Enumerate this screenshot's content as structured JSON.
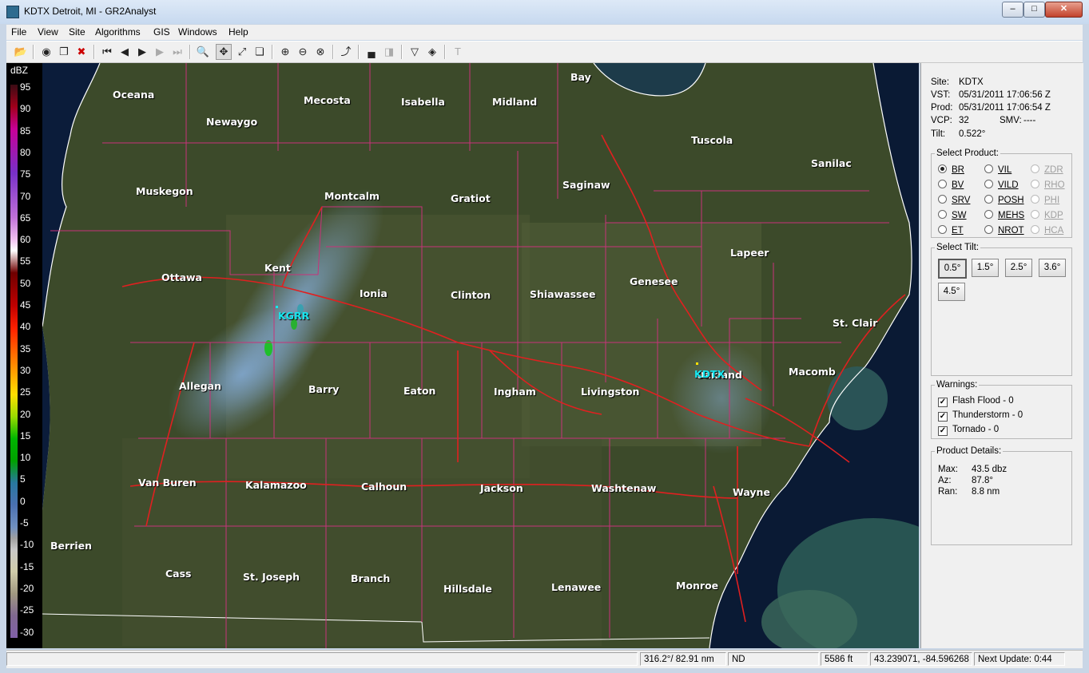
{
  "window": {
    "title": "KDTX Detroit, MI - GR2Analyst",
    "minimize": "–",
    "maximize": "□",
    "close": "✕"
  },
  "menu": [
    "File",
    "View",
    "Site",
    "Algorithms",
    "GIS",
    "Windows",
    "Help"
  ],
  "legend": {
    "unit": "dBZ",
    "labels": [
      "95",
      "90",
      "85",
      "80",
      "75",
      "70",
      "65",
      "60",
      "55",
      "50",
      "45",
      "40",
      "35",
      "30",
      "25",
      "20",
      "15",
      "10",
      "5",
      "0",
      "-5",
      "-10",
      "-15",
      "-20",
      "-25",
      "-30"
    ]
  },
  "map": {
    "counties": [
      {
        "name": "Oceana"
      },
      {
        "name": "Mecosta"
      },
      {
        "name": "Isabella"
      },
      {
        "name": "Midland"
      },
      {
        "name": "Bay"
      },
      {
        "name": "Newaygo"
      },
      {
        "name": "Tuscola"
      },
      {
        "name": "Sanilac"
      },
      {
        "name": "Muskegon"
      },
      {
        "name": "Montcalm"
      },
      {
        "name": "Gratiot"
      },
      {
        "name": "Saginaw"
      },
      {
        "name": "Lapeer"
      },
      {
        "name": "Kent"
      },
      {
        "name": "Ottawa"
      },
      {
        "name": "Genesee"
      },
      {
        "name": "Ionia"
      },
      {
        "name": "Clinton"
      },
      {
        "name": "Shiawassee"
      },
      {
        "name": "St. Clair"
      },
      {
        "name": "Oakland"
      },
      {
        "name": "Macomb"
      },
      {
        "name": "Allegan"
      },
      {
        "name": "Barry"
      },
      {
        "name": "Eaton"
      },
      {
        "name": "Ingham"
      },
      {
        "name": "Livingston"
      },
      {
        "name": "Van Buren"
      },
      {
        "name": "Kalamazoo"
      },
      {
        "name": "Calhoun"
      },
      {
        "name": "Jackson"
      },
      {
        "name": "Washtenaw"
      },
      {
        "name": "Wayne"
      },
      {
        "name": "Berrien"
      },
      {
        "name": "Cass"
      },
      {
        "name": "St. Joseph"
      },
      {
        "name": "Branch"
      },
      {
        "name": "Hillsdale"
      },
      {
        "name": "Lenawee"
      },
      {
        "name": "Monroe"
      }
    ],
    "radars": [
      {
        "name": "KGRR"
      },
      {
        "name": "KDTX"
      }
    ]
  },
  "info": {
    "site_label": "Site:",
    "site": "KDTX",
    "vst_label": "VST:",
    "vst": "05/31/2011  17:06:56 Z",
    "prod_label": "Prod:",
    "prod": "05/31/2011  17:06:54 Z",
    "vcp_label": "VCP:",
    "vcp": "32",
    "smv_label": "SMV:",
    "smv": "----",
    "tilt_label": "Tilt:",
    "tilt": "0.522°"
  },
  "select_product": {
    "title": "Select Product:",
    "options": [
      {
        "label": "BR",
        "selected": true,
        "enabled": true
      },
      {
        "label": "VIL",
        "selected": false,
        "enabled": true
      },
      {
        "label": "ZDR",
        "selected": false,
        "enabled": false
      },
      {
        "label": "BV",
        "selected": false,
        "enabled": true
      },
      {
        "label": "VILD",
        "selected": false,
        "enabled": true
      },
      {
        "label": "RHO",
        "selected": false,
        "enabled": false
      },
      {
        "label": "SRV",
        "selected": false,
        "enabled": true
      },
      {
        "label": "POSH",
        "selected": false,
        "enabled": true
      },
      {
        "label": "PHI",
        "selected": false,
        "enabled": false
      },
      {
        "label": "SW",
        "selected": false,
        "enabled": true
      },
      {
        "label": "MEHS",
        "selected": false,
        "enabled": true
      },
      {
        "label": "KDP",
        "selected": false,
        "enabled": false
      },
      {
        "label": "ET",
        "selected": false,
        "enabled": true
      },
      {
        "label": "NROT",
        "selected": false,
        "enabled": true
      },
      {
        "label": "HCA",
        "selected": false,
        "enabled": false
      }
    ]
  },
  "select_tilt": {
    "title": "Select Tilt:",
    "options": [
      "0.5°",
      "1.5°",
      "2.5°",
      "3.6°",
      "4.5°"
    ],
    "selected": "0.5°"
  },
  "warnings": {
    "title": "Warnings:",
    "items": [
      {
        "label": "Flash Flood - 0",
        "checked": true
      },
      {
        "label": "Thunderstorm - 0",
        "checked": true
      },
      {
        "label": "Tornado - 0",
        "checked": true
      }
    ]
  },
  "details": {
    "title": "Product Details:",
    "max_label": "Max:",
    "max": "43.5 dbz",
    "az_label": "Az:",
    "az": "87.8°",
    "ran_label": "Ran:",
    "ran": "8.8 nm"
  },
  "status": {
    "bearing": "316.2°/ 82.91 nm",
    "value": "ND",
    "height": "5586 ft",
    "coords": "43.239071, -84.596268",
    "next_update": "Next Update: 0:44"
  }
}
